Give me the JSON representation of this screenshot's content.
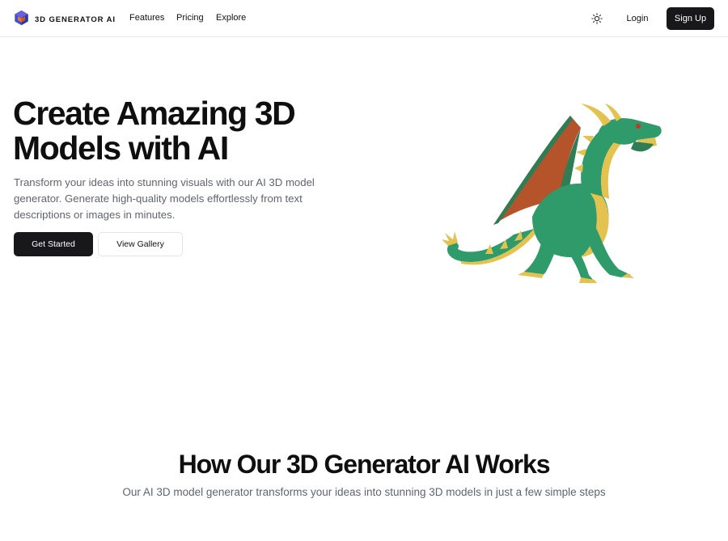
{
  "brand": {
    "name": "3D GENERATOR AI",
    "logo_icon": "cube-logo-icon",
    "logo_colors": [
      "#3b4fd8",
      "#e8742c",
      "#6a5fe0"
    ]
  },
  "nav": {
    "links": [
      "Features",
      "Pricing",
      "Explore"
    ],
    "theme_icon": "sun-icon",
    "login_label": "Login",
    "signup_label": "Sign Up"
  },
  "hero": {
    "title_line1": "Create Amazing 3D",
    "title_line2": "Models with AI",
    "description": "Transform your ideas into stunning visuals with our AI 3D model generator. Generate high-quality models effortlessly from text descriptions or images in minutes.",
    "primary_cta": "Get Started",
    "secondary_cta": "View Gallery",
    "image_subject": "green-dragon-3d-model"
  },
  "how_it_works": {
    "title": "How Our 3D Generator AI Works",
    "description": "Our AI 3D model generator transforms your ideas into stunning 3D models in just a few simple steps"
  },
  "colors": {
    "primary_button": "#18181b",
    "body_text": "#111111",
    "muted_text": "#5f6470",
    "dragon_green": "#2f9a6a",
    "dragon_wing": "#b5532a",
    "dragon_spikes": "#e3c24f"
  }
}
